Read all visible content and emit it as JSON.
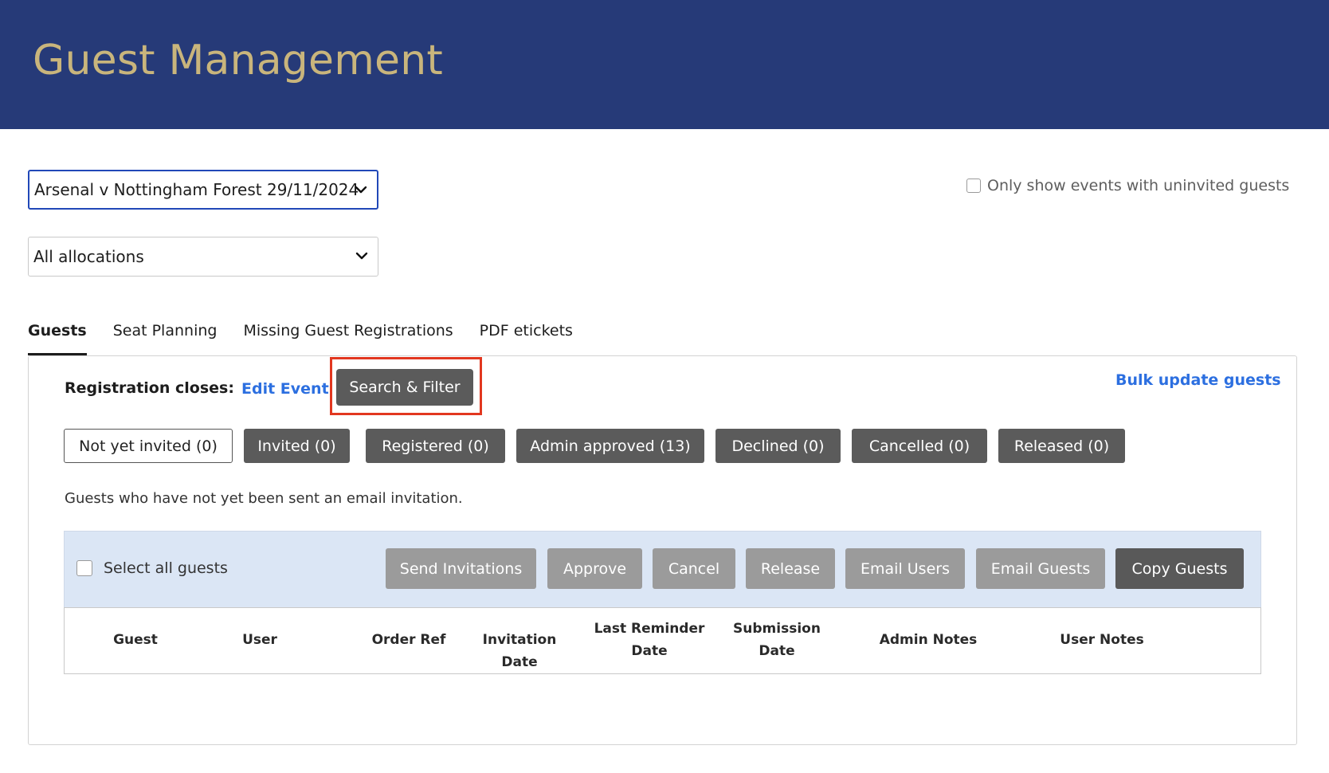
{
  "header": {
    "title": "Guest Management"
  },
  "filters": {
    "event_select": "Arsenal v Nottingham Forest 29/11/2024",
    "allocation_select": "All allocations",
    "only_uninvited_label": "Only show events with uninvited guests"
  },
  "tabs": [
    {
      "label": "Guests",
      "active": true
    },
    {
      "label": "Seat Planning",
      "active": false
    },
    {
      "label": "Missing Guest Registrations",
      "active": false
    },
    {
      "label": "PDF etickets",
      "active": false
    }
  ],
  "panel": {
    "registration_closes_label": "Registration closes:",
    "edit_event_link": "Edit Event",
    "search_filter_button": "Search & Filter",
    "bulk_update_link": "Bulk update guests",
    "status_filters": [
      {
        "label": "Not yet invited (0)",
        "selected": true
      },
      {
        "label": "Invited (0)",
        "selected": false
      },
      {
        "label": "Registered (0)",
        "selected": false
      },
      {
        "label": "Admin approved (13)",
        "selected": false
      },
      {
        "label": "Declined (0)",
        "selected": false
      },
      {
        "label": "Cancelled (0)",
        "selected": false
      },
      {
        "label": "Released (0)",
        "selected": false
      }
    ],
    "description": "Guests who have not yet been sent an email invitation.",
    "select_all_label": "Select all guests",
    "actions": [
      {
        "label": "Send Invitations",
        "enabled": false
      },
      {
        "label": "Approve",
        "enabled": false
      },
      {
        "label": "Cancel",
        "enabled": false
      },
      {
        "label": "Release",
        "enabled": false
      },
      {
        "label": "Email Users",
        "enabled": false
      },
      {
        "label": "Email Guests",
        "enabled": false
      },
      {
        "label": "Copy Guests",
        "enabled": true
      }
    ],
    "table_headers": [
      {
        "line1": "Guest",
        "line2": ""
      },
      {
        "line1": "User",
        "line2": ""
      },
      {
        "line1": "Order Ref",
        "line2": ""
      },
      {
        "line1": "Invitation Date",
        "line2": ""
      },
      {
        "line1": "Last Reminder",
        "line2": "Date"
      },
      {
        "line1": "Submission",
        "line2": "Date"
      },
      {
        "line1": "Admin Notes",
        "line2": ""
      },
      {
        "line1": "User Notes",
        "line2": ""
      }
    ]
  },
  "colors": {
    "header_bg": "#263a78",
    "title_gold": "#c9b57c",
    "link_blue": "#2c6fe0",
    "highlight_red": "#e2371f",
    "button_dark": "#5b5b5b",
    "button_disabled": "#9b9b9b",
    "actionbar_bg": "#dbe6f5"
  }
}
